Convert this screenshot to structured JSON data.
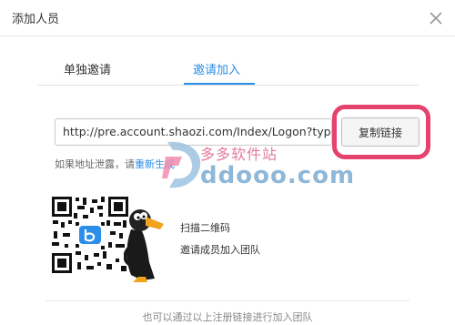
{
  "dialog": {
    "title": "添加人员",
    "close_icon": "close-icon"
  },
  "tabs": [
    {
      "label": "单独邀请",
      "active": false
    },
    {
      "label": "邀请加入",
      "active": true
    }
  ],
  "invite": {
    "link_value": "http://pre.account.shaozi.com/Index/Logon?type=",
    "copy_label": "复制链接",
    "hint_prefix": "如果地址泄露，请",
    "hint_link": "重新生成",
    "scan_text": "扫描二维码",
    "invite_text": "邀请成员加入团队"
  },
  "footer": {
    "text": "也可以通过以上注册链接进行加入团队"
  },
  "watermark": {
    "cn": "多多软件站",
    "en": "ddooo.com"
  },
  "colors": {
    "accent": "#2b8ee8",
    "highlight": "#e5426d"
  }
}
